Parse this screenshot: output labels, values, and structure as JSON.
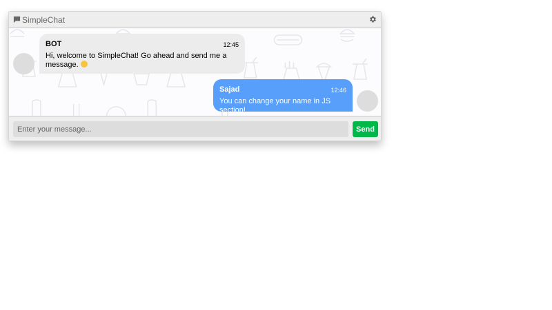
{
  "header": {
    "title": "SimpleChat",
    "title_icon": "chat-bubble-icon",
    "settings_icon": "gear-icon"
  },
  "messages": [
    {
      "side": "left",
      "name": "BOT",
      "time": "12:45",
      "text": "Hi, welcome to SimpleChat! Go ahead and send me a message.",
      "emoji": "😄"
    },
    {
      "side": "right",
      "name": "Sajad",
      "time": "12:46",
      "text": "You can change your name in JS section!"
    }
  ],
  "composer": {
    "placeholder": "Enter your message...",
    "send_label": "Send"
  },
  "colors": {
    "accent_send": "#00b74a",
    "own_bubble": "#579ffb",
    "other_bubble": "#ececec"
  }
}
